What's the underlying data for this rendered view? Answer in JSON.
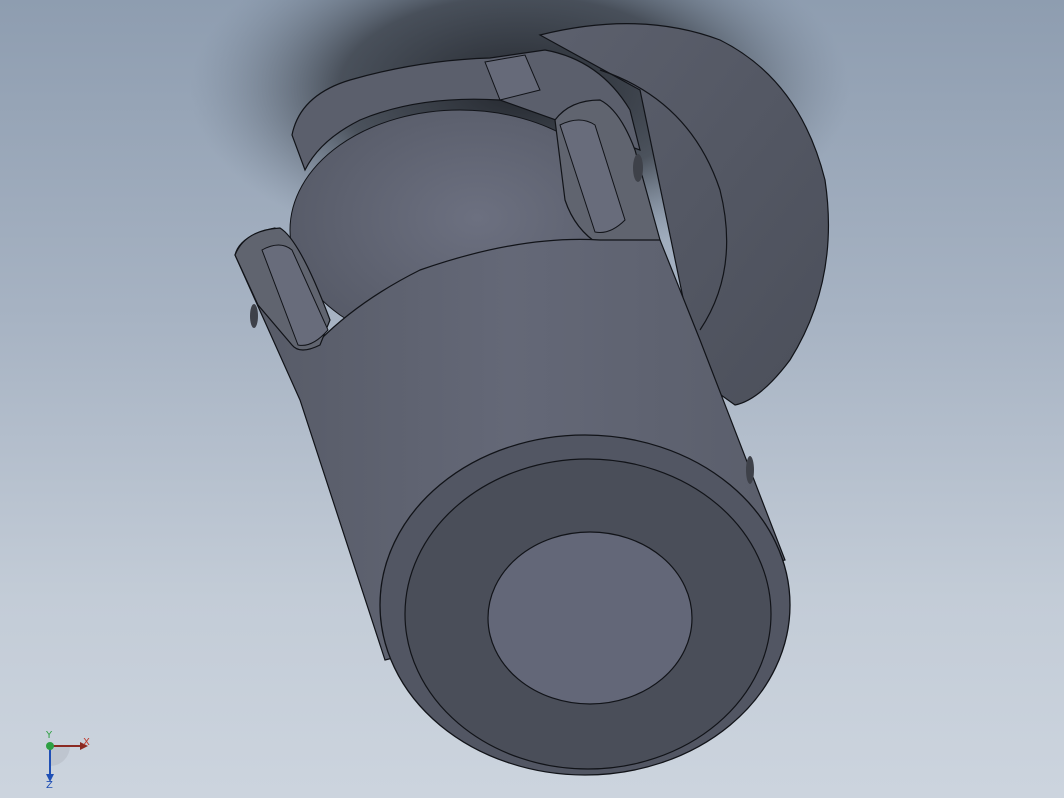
{
  "viewport": {
    "triad": {
      "x_label": "X",
      "y_label": "Y",
      "z_label": "Z",
      "x_color": "#c0392b",
      "y_color": "#2ea043",
      "z_color": "#1f4fb5"
    },
    "model": {
      "description_icon": "universal-joint-3d-model",
      "body_color": "#5f6472",
      "shadow_color": "#2a2d33",
      "edge_color": "#111318"
    }
  }
}
